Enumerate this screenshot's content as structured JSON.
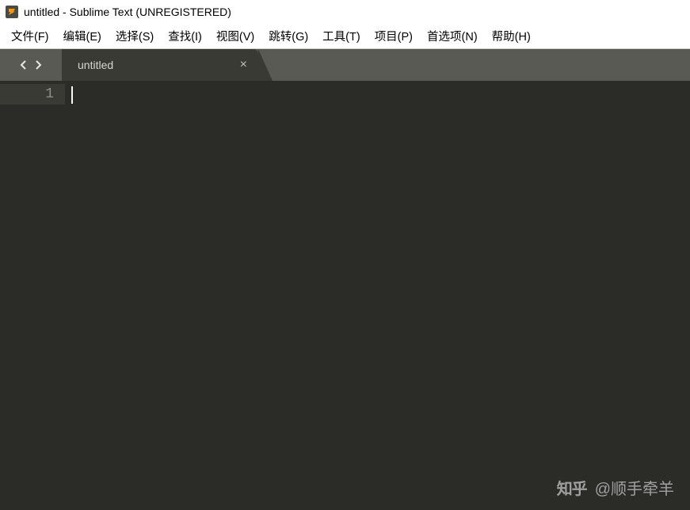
{
  "window": {
    "title": "untitled - Sublime Text (UNREGISTERED)"
  },
  "menu": {
    "file": "文件(F)",
    "edit": "编辑(E)",
    "select": "选择(S)",
    "find": "查找(I)",
    "view": "视图(V)",
    "goto": "跳转(G)",
    "tools": "工具(T)",
    "project": "项目(P)",
    "preferences": "首选项(N)",
    "help": "帮助(H)"
  },
  "tabs": {
    "active": {
      "label": "untitled"
    }
  },
  "editor": {
    "line_numbers": [
      "1"
    ],
    "content": ""
  },
  "watermark": {
    "logo": "知乎",
    "text": "@顺手牵羊"
  }
}
